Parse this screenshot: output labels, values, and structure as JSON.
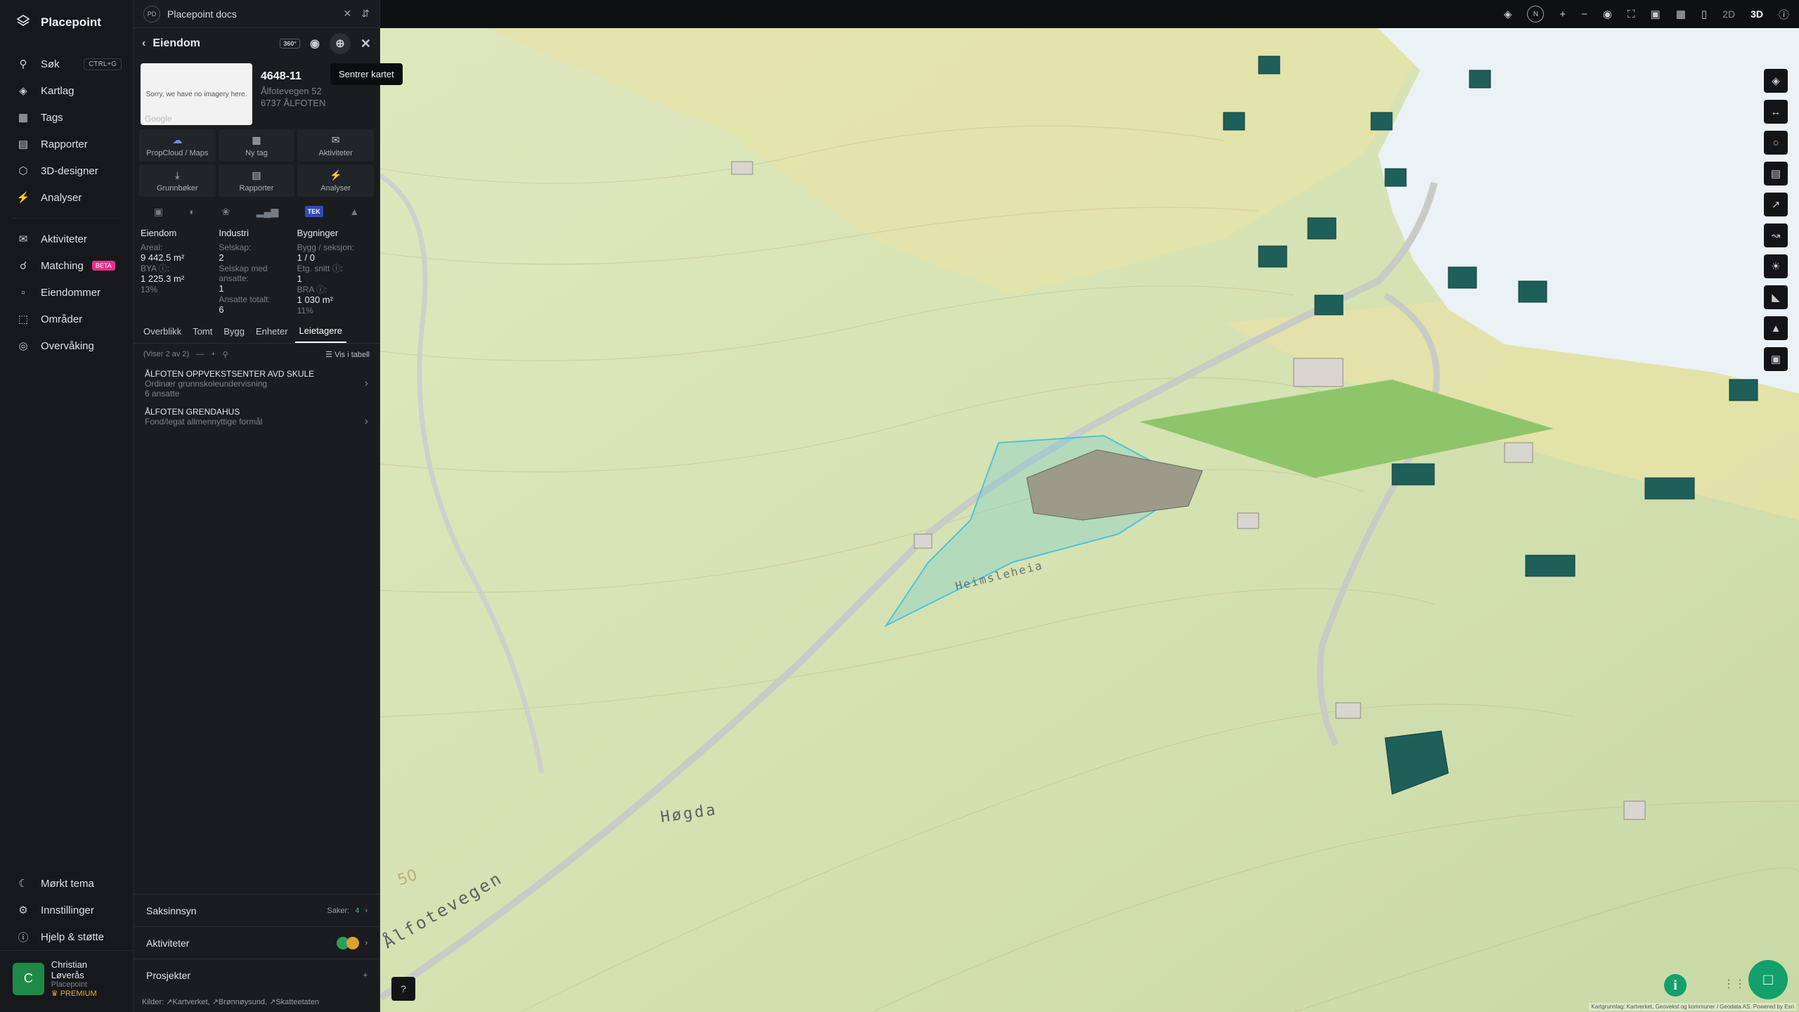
{
  "app": {
    "name": "Placepoint"
  },
  "nav": {
    "items": [
      {
        "label": "Søk",
        "shortcut": "CTRL+G",
        "icon": "search-icon"
      },
      {
        "label": "Kartlag",
        "icon": "layers-icon"
      },
      {
        "label": "Tags",
        "icon": "bookmark-icon"
      },
      {
        "label": "Rapporter",
        "icon": "chart-icon"
      },
      {
        "label": "3D-designer",
        "icon": "cube-icon"
      },
      {
        "label": "Analyser",
        "icon": "bolt-icon"
      }
    ],
    "items2": [
      {
        "label": "Aktiviteter",
        "icon": "chat-icon"
      },
      {
        "label": "Matching",
        "badge": "BETA",
        "icon": "match-icon"
      },
      {
        "label": "Eiendommer",
        "icon": "building-icon"
      },
      {
        "label": "Områder",
        "icon": "area-icon"
      },
      {
        "label": "Overvåking",
        "icon": "monitor-icon"
      }
    ],
    "bottom": [
      {
        "label": "Mørkt tema",
        "icon": "moon-icon"
      },
      {
        "label": "Innstillinger",
        "icon": "gear-icon"
      },
      {
        "label": "Hjelp & støtte",
        "icon": "help-icon"
      }
    ],
    "user": {
      "initial": "C",
      "name": "Christian Løverås",
      "org": "Placepoint",
      "plan": "PREMIUM"
    }
  },
  "panel": {
    "tab_badge": "PD",
    "tab_title": "Placepoint docs",
    "title": "Eiendom",
    "streetview": "360°",
    "tooltip": "Sentrer kartet",
    "thumb_text": "Sorry, we have no imagery here.",
    "thumb_brand": "Google",
    "property_id": "4648-11",
    "address_line1": "Ålfotevegen 52",
    "address_line2": "6737 ÅLFOTEN",
    "actions": [
      {
        "label": "PropCloud / Maps",
        "icon": "cloud-icon"
      },
      {
        "label": "Ny tag",
        "icon": "bookmark-icon"
      },
      {
        "label": "Aktiviteter",
        "icon": "chat-icon"
      },
      {
        "label": "Grunnbøker",
        "icon": "download-icon"
      },
      {
        "label": "Rapporter",
        "icon": "chart-icon"
      },
      {
        "label": "Analyser",
        "icon": "bolt-icon"
      }
    ],
    "layer_tek": "TEK",
    "stats": {
      "eiendom": {
        "title": "Eiendom",
        "areal_label": "Areal:",
        "areal_value": "9 442.5 m²",
        "bya_label": "BYA ⓘ:",
        "bya_value": "1 225.3 m²",
        "bya_pct": "13%"
      },
      "industri": {
        "title": "Industri",
        "selskap_label": "Selskap:",
        "selskap_value": "2",
        "ansatte_label": "Selskap med ansatte:",
        "ansatte_value": "1",
        "total_label": "Ansatte totalt:",
        "total_value": "6"
      },
      "bygninger": {
        "title": "Bygninger",
        "bygg_label": "Bygg / seksjon:",
        "bygg_value": "1 / 0",
        "etg_label": "Etg. snitt ⓘ:",
        "etg_value": "1",
        "bra_label": "BRA ⓘ:",
        "bra_value": "1 030 m²",
        "bra_pct": "11%"
      }
    },
    "subtabs": [
      "Overblikk",
      "Tomt",
      "Bygg",
      "Enheter",
      "Leietagere"
    ],
    "list_count": "(Viser 2 av 2)",
    "list_table": "Vis i tabell",
    "tenants": [
      {
        "name": "ÅLFOTEN OPPVEKSTSENTER AVD SKULE",
        "desc": "Ordinær grunnskoleundervisning",
        "extra": "6 ansatte"
      },
      {
        "name": "ÅLFOTEN GRENDAHUS",
        "desc": "Fond/legat allmennyttige formål",
        "extra": ""
      }
    ],
    "footer": {
      "saksinnsyn": "Saksinnsyn",
      "saker_label": "Saker:",
      "saker_value": "4",
      "aktiviteter": "Aktiviteter",
      "prosjekter": "Prosjekter",
      "sources_label": "Kilder:",
      "sources": [
        "Kartverket",
        "Brønnøysund",
        "Skatteetaten"
      ]
    }
  },
  "topbar": {
    "mode_2d": "2D",
    "mode_3d": "3D",
    "compass": "N"
  },
  "map": {
    "labels": {
      "road": "Ålfotevegen",
      "hill": "Høgda",
      "place": "Heimsleheia",
      "contour": "50"
    },
    "attribution": "Kartgrunnlag: Kartverket, Geovekst og kommuner / Geodata AS. Powered by Esri",
    "colors": {
      "terrain": "#d7e3b4",
      "farmland": "#ece5a8",
      "water": "#eaf2f6",
      "building": "#1e5f5a",
      "selection": "#4fc3d8"
    }
  }
}
